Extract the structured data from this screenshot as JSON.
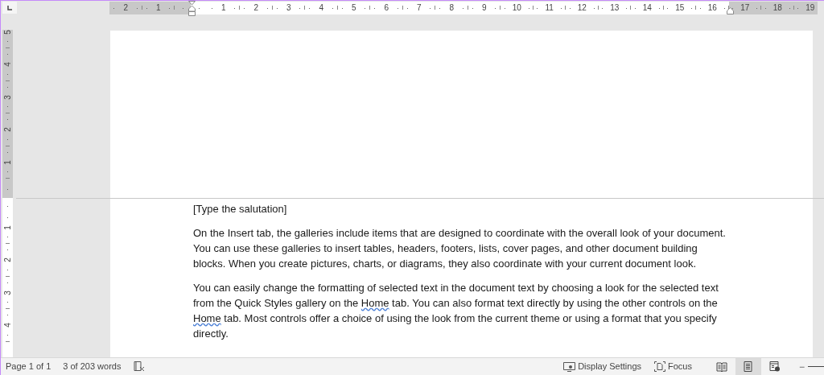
{
  "horizontal_ruler": {
    "left_margin_labels": [
      "2",
      "1"
    ],
    "labels": [
      "1",
      "2",
      "3",
      "4",
      "5",
      "6",
      "7",
      "8",
      "9",
      "10",
      "11",
      "12",
      "13",
      "14",
      "15",
      "16"
    ],
    "right_margin_labels": [
      "17",
      "18",
      "19"
    ]
  },
  "vertical_ruler": {
    "top_margin_labels": [
      "5",
      "4",
      "3",
      "2",
      "1"
    ],
    "labels": [
      "1",
      "2",
      "3",
      "4"
    ]
  },
  "document": {
    "salutation": "[Type the salutation]",
    "paragraphs": [
      {
        "segments": [
          {
            "text": "On the Insert tab, the galleries include items that are designed to coordinate with the overall look of your document. You can use these galleries to insert tables, headers, footers, lists, cover pages, and other document building blocks. When you create pictures, charts, or diagrams, they also coordinate with your current document look.",
            "flagged": false
          }
        ]
      },
      {
        "segments": [
          {
            "text": "You can easily change the formatting of selected text in the document text by choosing a look for the selected text from the Quick Styles gallery on the ",
            "flagged": false
          },
          {
            "text": "Home",
            "flagged": true
          },
          {
            "text": " tab. You can also format text directly by using the other controls on the ",
            "flagged": false
          },
          {
            "text": "Home",
            "flagged": true
          },
          {
            "text": " tab. Most controls offer a choice of using the look from the current theme or using a format that you specify directly.",
            "flagged": false
          }
        ]
      }
    ]
  },
  "status_bar": {
    "page": "Page 1 of 1",
    "words": "3 of 203 words",
    "display_settings": "Display Settings",
    "focus": "Focus",
    "views": [
      {
        "kind": "read",
        "selected": false
      },
      {
        "kind": "print",
        "selected": true
      },
      {
        "kind": "web",
        "selected": false
      }
    ],
    "zoom_out": "−"
  }
}
